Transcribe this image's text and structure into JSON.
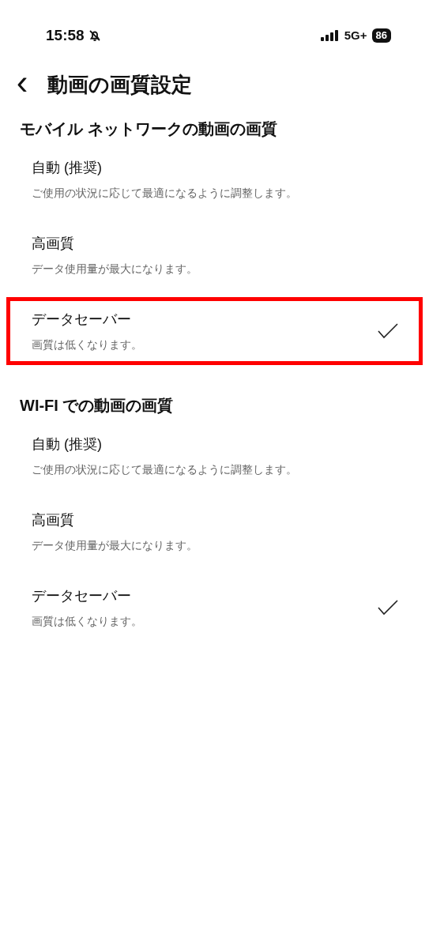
{
  "status_bar": {
    "time": "15:58",
    "network": "5G+",
    "battery": "86"
  },
  "header": {
    "back": "‹",
    "title": "動画の画質設定"
  },
  "sections": [
    {
      "title": "モバイル ネットワークの動画の画質",
      "options": [
        {
          "label": "自動 (推奨)",
          "description": "ご使用の状況に応じて最適になるように調整します。",
          "selected": false,
          "highlighted": false
        },
        {
          "label": "高画質",
          "description": "データ使用量が最大になります。",
          "selected": false,
          "highlighted": false
        },
        {
          "label": "データセーバー",
          "description": "画質は低くなります。",
          "selected": true,
          "highlighted": true
        }
      ]
    },
    {
      "title": "WI-FI での動画の画質",
      "options": [
        {
          "label": "自動 (推奨)",
          "description": "ご使用の状況に応じて最適になるように調整します。",
          "selected": false,
          "highlighted": false
        },
        {
          "label": "高画質",
          "description": "データ使用量が最大になります。",
          "selected": false,
          "highlighted": false
        },
        {
          "label": "データセーバー",
          "description": "画質は低くなります。",
          "selected": true,
          "highlighted": false
        }
      ]
    }
  ]
}
